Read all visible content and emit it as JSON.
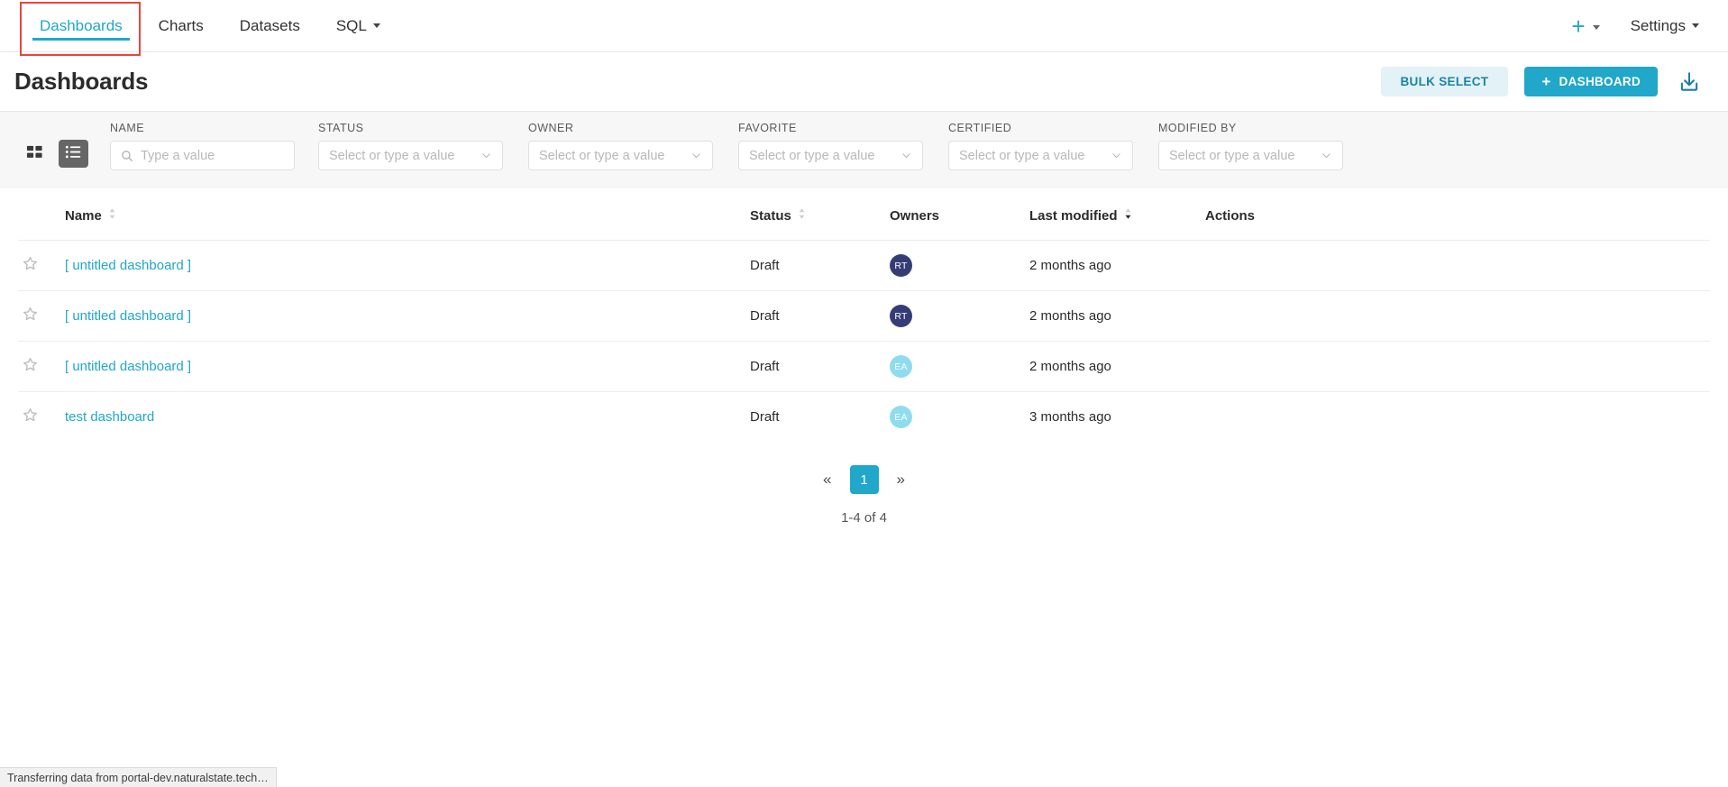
{
  "navbar": {
    "tabs": [
      {
        "label": "Dashboards",
        "active": true,
        "has_caret": false
      },
      {
        "label": "Charts",
        "active": false,
        "has_caret": false
      },
      {
        "label": "Datasets",
        "active": false,
        "has_caret": false
      },
      {
        "label": "SQL",
        "active": false,
        "has_caret": true
      }
    ],
    "plus_label": "+",
    "settings_label": "Settings",
    "accent_color": "#20a7c9",
    "annotation_color": "#e8453c"
  },
  "header": {
    "title": "Dashboards",
    "bulk_select_label": "BULK SELECT",
    "new_dashboard_label": "DASHBOARD",
    "new_dashboard_plus": "+",
    "import_icon": "import-download-icon"
  },
  "filters": {
    "view_grid_icon": "card-view-icon",
    "view_list_icon": "list-view-icon",
    "active_view": "list",
    "name": {
      "label": "NAME",
      "placeholder": "Type a value",
      "value": ""
    },
    "selects": [
      {
        "label": "STATUS",
        "placeholder": "Select or type a value",
        "value": ""
      },
      {
        "label": "OWNER",
        "placeholder": "Select or type a value",
        "value": ""
      },
      {
        "label": "FAVORITE",
        "placeholder": "Select or type a value",
        "value": ""
      },
      {
        "label": "CERTIFIED",
        "placeholder": "Select or type a value",
        "value": ""
      },
      {
        "label": "MODIFIED BY",
        "placeholder": "Select or type a value",
        "value": ""
      }
    ]
  },
  "table": {
    "columns": {
      "name": "Name",
      "status": "Status",
      "owners": "Owners",
      "last_modified": "Last modified",
      "actions": "Actions"
    },
    "sort": {
      "column": "Last modified",
      "direction": "desc"
    },
    "rows": [
      {
        "favorite": false,
        "name": "[ untitled dashboard ]",
        "status": "Draft",
        "owner_initials": "RT",
        "owner_color": "#353d76",
        "last_modified": "2 months ago"
      },
      {
        "favorite": false,
        "name": "[ untitled dashboard ]",
        "status": "Draft",
        "owner_initials": "RT",
        "owner_color": "#353d76",
        "last_modified": "2 months ago"
      },
      {
        "favorite": false,
        "name": "[ untitled dashboard ]",
        "status": "Draft",
        "owner_initials": "EA",
        "owner_color": "#8fdcef",
        "last_modified": "2 months ago"
      },
      {
        "favorite": false,
        "name": "test dashboard",
        "status": "Draft",
        "owner_initials": "EA",
        "owner_color": "#8fdcef",
        "last_modified": "3 months ago"
      }
    ]
  },
  "pagination": {
    "prev_label": "«",
    "next_label": "»",
    "current_page": "1",
    "range_text": "1-4 of 4"
  },
  "status_bar": {
    "text": "Transferring data from portal-dev.naturalstate.tech…"
  }
}
